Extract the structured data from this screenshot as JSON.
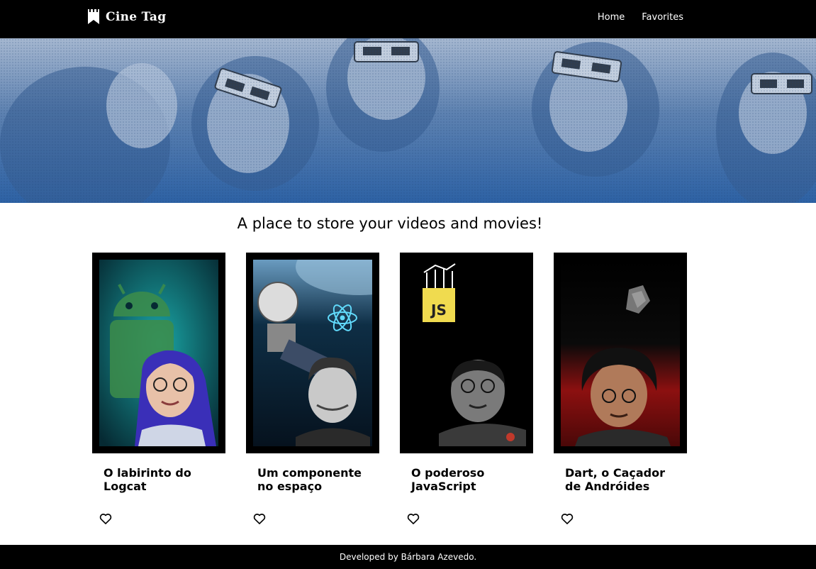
{
  "app": {
    "brand": "Cine Tag",
    "logo_icon": "clapperboard-bookmark-icon",
    "accent_color": "#2d5d9a"
  },
  "nav": {
    "items": [
      {
        "label": "Home"
      },
      {
        "label": "Favorites"
      }
    ]
  },
  "banner": {
    "image": "audience-wearing-3d-glasses-photo"
  },
  "main": {
    "tagline": "A place to store your videos and movies!"
  },
  "videos": [
    {
      "title": "O labirinto do Logcat",
      "thumbnail": "android-robot-host-photo",
      "favorite_icon": "heart-outline-icon"
    },
    {
      "title": "Um componente no espaço",
      "thumbnail": "react-satellite-host-photo",
      "favorite_icon": "heart-outline-icon"
    },
    {
      "title": "O poderoso JavaScript",
      "thumbnail": "javascript-logo-host-photo",
      "favorite_icon": "heart-outline-icon"
    },
    {
      "title": "Dart, o Caçador de Andróides",
      "thumbnail": "dart-logo-host-photo",
      "favorite_icon": "heart-outline-icon"
    }
  ],
  "footer": {
    "text": "Developed by Bárbara Azevedo."
  }
}
